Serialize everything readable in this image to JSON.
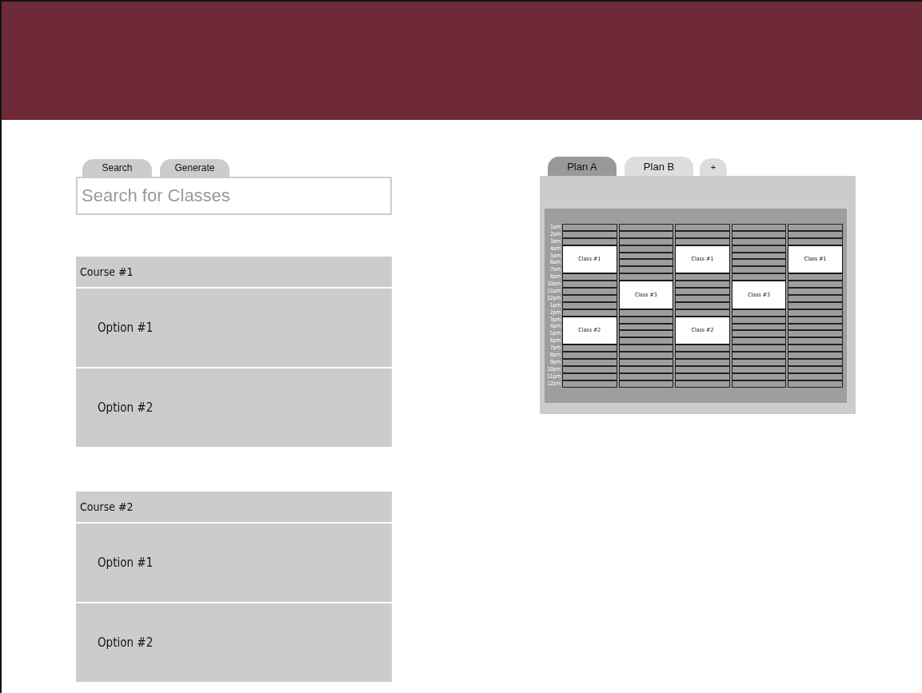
{
  "search_tabs": [
    {
      "label": "Search"
    },
    {
      "label": "Generate"
    }
  ],
  "search": {
    "placeholder": "Search for Classes"
  },
  "courses": [
    {
      "title": "Course #1",
      "options": [
        "Option #1",
        "Option #2"
      ]
    },
    {
      "title": "Course #2",
      "options": [
        "Option #1",
        "Option #2"
      ]
    }
  ],
  "plan_tabs": [
    {
      "label": "Plan A",
      "selected": true
    },
    {
      "label": "Plan B",
      "selected": false
    }
  ],
  "add_tab": "+",
  "schedule": {
    "times": [
      "1am",
      "2am",
      "3am",
      "4am",
      "5am",
      "6am",
      "7am",
      "8am",
      "10am",
      "11am",
      "12pm",
      "1pm",
      "2pm",
      "3pm",
      "4pm",
      "5pm",
      "6pm",
      "7pm",
      "8pm",
      "9pm",
      "10pm",
      "11pm",
      "12am"
    ],
    "days": [
      {
        "entries": [
          {
            "kind": "gap"
          },
          {
            "kind": "gap"
          },
          {
            "kind": "gap"
          },
          {
            "kind": "class",
            "label": "Class #1"
          },
          {
            "kind": "gap"
          },
          {
            "kind": "gap"
          },
          {
            "kind": "gap"
          },
          {
            "kind": "gap"
          },
          {
            "kind": "gap"
          },
          {
            "kind": "gap"
          },
          {
            "kind": "class",
            "label": "Class #2"
          },
          {
            "kind": "gap"
          },
          {
            "kind": "gap"
          },
          {
            "kind": "gap"
          },
          {
            "kind": "gap"
          },
          {
            "kind": "gap"
          },
          {
            "kind": "gap"
          }
        ]
      },
      {
        "entries": [
          {
            "kind": "gap"
          },
          {
            "kind": "gap"
          },
          {
            "kind": "gap"
          },
          {
            "kind": "gap"
          },
          {
            "kind": "gap"
          },
          {
            "kind": "gap"
          },
          {
            "kind": "gap"
          },
          {
            "kind": "gap"
          },
          {
            "kind": "class",
            "label": "Class #3"
          },
          {
            "kind": "gap"
          },
          {
            "kind": "gap"
          },
          {
            "kind": "gap"
          },
          {
            "kind": "gap"
          },
          {
            "kind": "gap"
          },
          {
            "kind": "gap"
          },
          {
            "kind": "gap"
          },
          {
            "kind": "gap"
          },
          {
            "kind": "gap"
          },
          {
            "kind": "gap"
          },
          {
            "kind": "gap"
          }
        ]
      },
      {
        "entries": [
          {
            "kind": "gap"
          },
          {
            "kind": "gap"
          },
          {
            "kind": "gap"
          },
          {
            "kind": "class",
            "label": "Class #1"
          },
          {
            "kind": "gap"
          },
          {
            "kind": "gap"
          },
          {
            "kind": "gap"
          },
          {
            "kind": "gap"
          },
          {
            "kind": "gap"
          },
          {
            "kind": "gap"
          },
          {
            "kind": "class",
            "label": "Class #2"
          },
          {
            "kind": "gap"
          },
          {
            "kind": "gap"
          },
          {
            "kind": "gap"
          },
          {
            "kind": "gap"
          },
          {
            "kind": "gap"
          },
          {
            "kind": "gap"
          }
        ]
      },
      {
        "entries": [
          {
            "kind": "gap"
          },
          {
            "kind": "gap"
          },
          {
            "kind": "gap"
          },
          {
            "kind": "gap"
          },
          {
            "kind": "gap"
          },
          {
            "kind": "gap"
          },
          {
            "kind": "gap"
          },
          {
            "kind": "gap"
          },
          {
            "kind": "class",
            "label": "Class #3"
          },
          {
            "kind": "gap"
          },
          {
            "kind": "gap"
          },
          {
            "kind": "gap"
          },
          {
            "kind": "gap"
          },
          {
            "kind": "gap"
          },
          {
            "kind": "gap"
          },
          {
            "kind": "gap"
          },
          {
            "kind": "gap"
          },
          {
            "kind": "gap"
          },
          {
            "kind": "gap"
          },
          {
            "kind": "gap"
          }
        ]
      },
      {
        "entries": [
          {
            "kind": "gap"
          },
          {
            "kind": "gap"
          },
          {
            "kind": "gap"
          },
          {
            "kind": "class",
            "label": "Class #1"
          },
          {
            "kind": "gap"
          },
          {
            "kind": "gap"
          },
          {
            "kind": "gap"
          },
          {
            "kind": "gap"
          },
          {
            "kind": "gap"
          },
          {
            "kind": "gap"
          },
          {
            "kind": "gap"
          },
          {
            "kind": "gap"
          },
          {
            "kind": "gap"
          },
          {
            "kind": "gap"
          },
          {
            "kind": "gap"
          },
          {
            "kind": "gap"
          },
          {
            "kind": "gap"
          },
          {
            "kind": "gap"
          },
          {
            "kind": "gap"
          },
          {
            "kind": "gap"
          }
        ]
      }
    ]
  }
}
